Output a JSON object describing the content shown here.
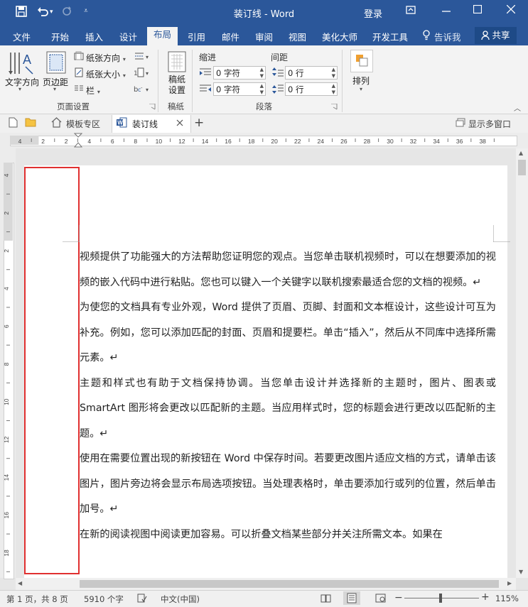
{
  "window": {
    "title": "装订线 - Word",
    "login": "登录"
  },
  "ribbon_tabs": [
    {
      "label": "文件"
    },
    {
      "label": "开始"
    },
    {
      "label": "插入"
    },
    {
      "label": "设计"
    },
    {
      "label": "布局"
    },
    {
      "label": "引用"
    },
    {
      "label": "邮件"
    },
    {
      "label": "审阅"
    },
    {
      "label": "视图"
    },
    {
      "label": "美化大师"
    },
    {
      "label": "开发工具"
    },
    {
      "label": "告诉我"
    }
  ],
  "share_label": "共享",
  "ribbon": {
    "text_direction": "文字方向",
    "margins": "页边距",
    "orientation": "纸张方向",
    "size": "纸张大小",
    "columns": "栏",
    "page_setup_group": "页面设置",
    "draft_paper": "稿纸设置",
    "draft_paper_group": "稿纸",
    "indent_header": "缩进",
    "spacing_header": "间距",
    "indent_left": "0 字符",
    "indent_right": "0 字符",
    "spacing_before": "0 行",
    "spacing_after": "0 行",
    "paragraph_group": "段落",
    "arrange": "排列"
  },
  "doc_tabs": {
    "templates": "模板专区",
    "document": "装订线",
    "show_multi_window": "显示多窗口"
  },
  "ruler_h": [
    "4",
    "2",
    "2",
    "4",
    "6",
    "8",
    "10",
    "12",
    "14",
    "16",
    "18",
    "20",
    "22",
    "24",
    "26",
    "28",
    "30",
    "32",
    "34",
    "36",
    "38"
  ],
  "ruler_v": [
    "4",
    "2",
    "2",
    "4",
    "6",
    "8",
    "10",
    "12",
    "14",
    "16",
    "18"
  ],
  "document": {
    "paragraphs": [
      "视频提供了功能强大的方法帮助您证明您的观点。当您单击联机视频时，可以在想要添加的视频的嵌入代码中进行粘贴。您也可以键入一个关键字以联机搜索最适合您的文档的视频。↵",
      "为使您的文档具有专业外观，Word 提供了页眉、页脚、封面和文本框设计，这些设计可互为补充。例如，您可以添加匹配的封面、页眉和提要栏。单击“插入”，然后从不同库中选择所需元素。↵",
      "主题和样式也有助于文档保持协调。当您单击设计并选择新的主题时，图片、图表或SmartArt 图形将会更改以匹配新的主题。当应用样式时，您的标题会进行更改以匹配新的主题。↵",
      "使用在需要位置出现的新按钮在 Word 中保存时间。若要更改图片适应文档的方式，请单击该图片，图片旁边将会显示布局选项按钮。当处理表格时，单击要添加行或列的位置，然后单击加号。↵",
      "在新的阅读视图中阅读更加容易。可以折叠文档某些部分并关注所需文本。如果在"
    ]
  },
  "status": {
    "page": "第 1 页，共 8 页",
    "words": "5910 个字",
    "language": "中文(中国)",
    "zoom": "115%"
  },
  "colors": {
    "accent": "#2b579a",
    "gutter_highlight": "#e03030"
  }
}
